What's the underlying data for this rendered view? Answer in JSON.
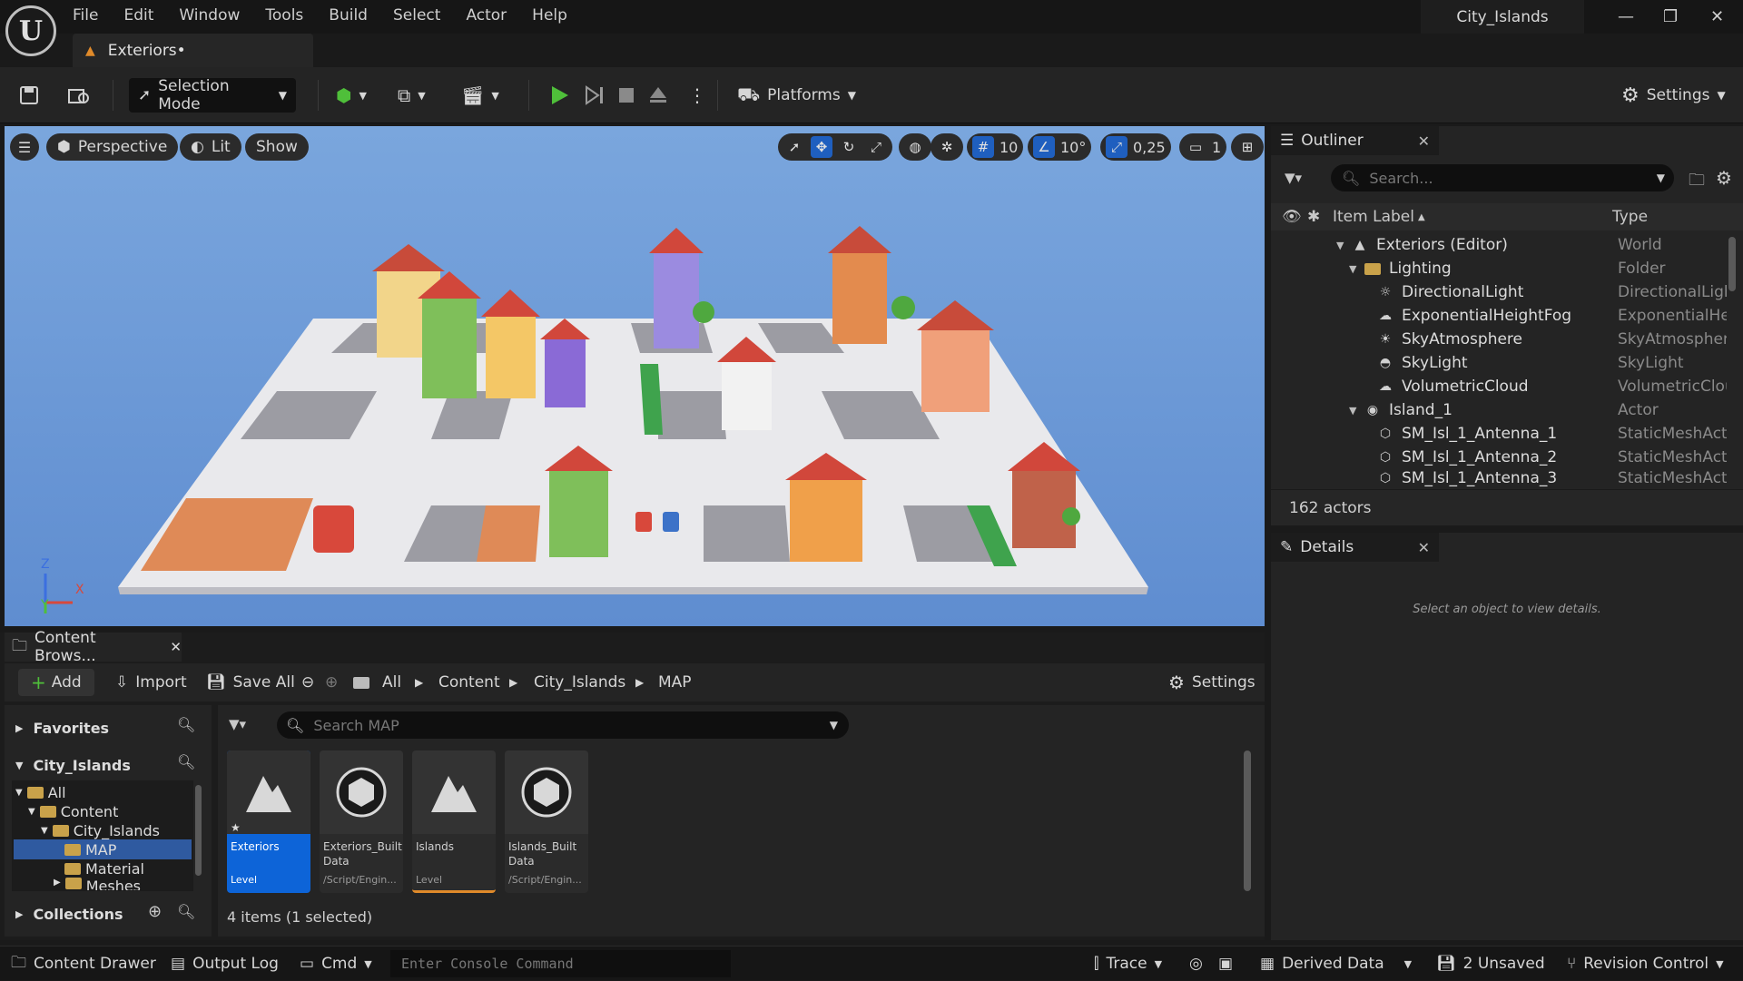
{
  "menu": [
    "File",
    "Edit",
    "Window",
    "Tools",
    "Build",
    "Select",
    "Actor",
    "Help"
  ],
  "logo_text": "U",
  "document_tab": "Exteriors•",
  "project_name": "City_Islands",
  "toolbar": {
    "selection_mode": "Selection Mode",
    "platforms": "Platforms",
    "settings": "Settings"
  },
  "viewport": {
    "perspective": "Perspective",
    "lit": "Lit",
    "show": "Show",
    "grid_snap": "10",
    "rot_snap": "10°",
    "scale_snap": "0,25",
    "camera_speed": "1",
    "axis_x": "X",
    "axis_y": "Y",
    "axis_z": "Z"
  },
  "outliner": {
    "title": "Outliner",
    "search_placeholder": "Search...",
    "col_label": "Item Label",
    "col_type": "Type",
    "rows": [
      {
        "label": "Exteriors (Editor)",
        "type": "World"
      },
      {
        "label": "Lighting",
        "type": "Folder"
      },
      {
        "label": "DirectionalLight",
        "type": "DirectionalLigh"
      },
      {
        "label": "ExponentialHeightFog",
        "type": "ExponentialHei"
      },
      {
        "label": "SkyAtmosphere",
        "type": "SkyAtmospher"
      },
      {
        "label": "SkyLight",
        "type": "SkyLight"
      },
      {
        "label": "VolumetricCloud",
        "type": "VolumetricClou"
      },
      {
        "label": "Island_1",
        "type": "Actor"
      },
      {
        "label": "SM_Isl_1_Antenna_1",
        "type": "StaticMeshAct"
      },
      {
        "label": "SM_Isl_1_Antenna_2",
        "type": "StaticMeshAct"
      },
      {
        "label": "SM_Isl_1_Antenna_3",
        "type": "StaticMeshAct"
      }
    ],
    "actor_count": "162 actors"
  },
  "details": {
    "title": "Details",
    "empty_message": "Select an object to view details."
  },
  "content_browser": {
    "tab": "Content Brows...",
    "add": "Add",
    "import": "Import",
    "save_all": "Save All",
    "breadcrumb": [
      "All",
      "Content",
      "City_Islands",
      "MAP"
    ],
    "settings": "Settings",
    "favorites": "Favorites",
    "project": "City_Islands",
    "tree": [
      "All",
      "Content",
      "City_Islands",
      "MAP",
      "Material",
      "Meshes"
    ],
    "collections": "Collections",
    "search_placeholder": "Search MAP",
    "assets": [
      {
        "name": "Exteriors",
        "kind": "Level"
      },
      {
        "name": "Exteriors_Built Data",
        "kind": "/Script/Engin..."
      },
      {
        "name": "Islands",
        "kind": "Level"
      },
      {
        "name": "Islands_Built Data",
        "kind": "/Script/Engin..."
      }
    ],
    "item_count": "4 items (1 selected)"
  },
  "statusbar": {
    "content_drawer": "Content Drawer",
    "output_log": "Output Log",
    "cmd": "Cmd",
    "console_placeholder": "Enter Console Command",
    "trace": "Trace",
    "derived_data": "Derived Data",
    "unsaved": "2 Unsaved",
    "revision_control": "Revision Control"
  },
  "colors": {
    "play_green": "#4fbf3a",
    "selection_blue": "#0d64d8",
    "sky_blue": "#6c98d6"
  }
}
